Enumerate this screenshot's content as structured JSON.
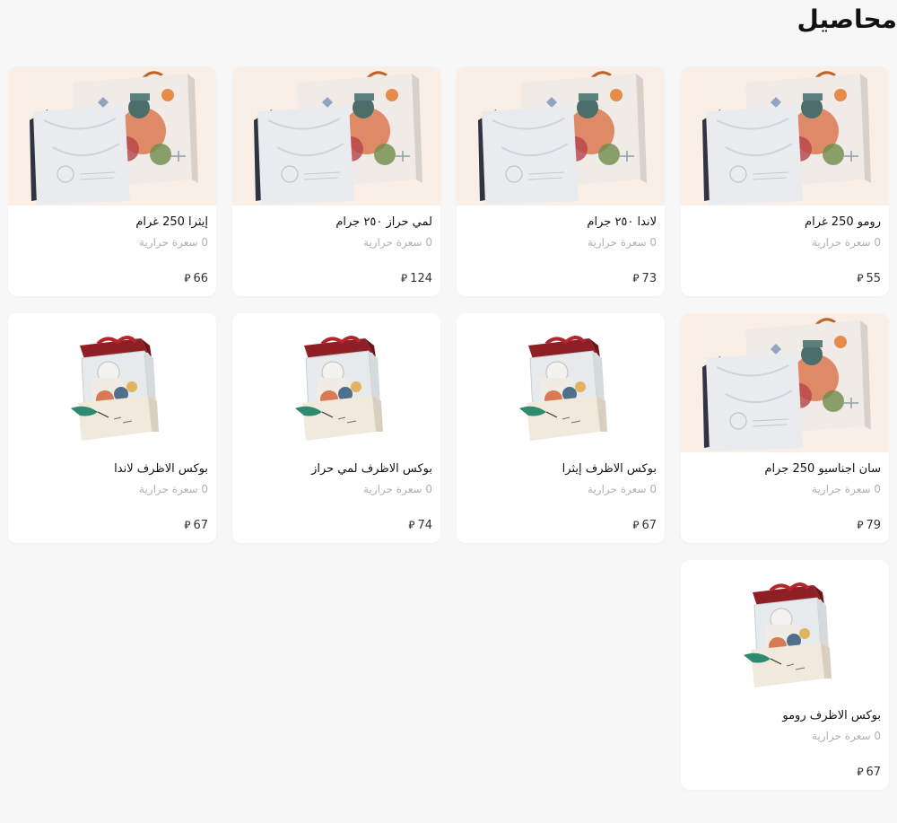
{
  "page": {
    "title": "محاصيل",
    "currency_symbol": "⃁",
    "calorie_label": "0 سعرة حرارية"
  },
  "products": [
    {
      "name": "رومو 250 غرام",
      "price": "55",
      "calories": "0 سعرة حرارية",
      "image": "coffee-bag-image"
    },
    {
      "name": "لاندا ٢٥٠ جرام",
      "price": "73",
      "calories": "0 سعرة حرارية",
      "image": "coffee-bag-image"
    },
    {
      "name": "لمي حراز ٢٥٠ جرام",
      "price": "124",
      "calories": "0 سعرة حرارية",
      "image": "coffee-bag-image"
    },
    {
      "name": "إيثرا 250 غرام",
      "price": "66",
      "calories": "0 سعرة حرارية",
      "image": "coffee-bag-image"
    },
    {
      "name": "سان اجناسيو 250 جرام",
      "price": "79",
      "calories": "0 سعرة حرارية",
      "image": "coffee-bag-image"
    },
    {
      "name": "بوكس الاظرف إيثرا",
      "price": "67",
      "calories": "0 سعرة حرارية",
      "image": "gift-box-image"
    },
    {
      "name": "بوكس الاظرف لمي حراز",
      "price": "74",
      "calories": "0 سعرة حرارية",
      "image": "gift-box-image"
    },
    {
      "name": "بوكس الاظرف لاندا",
      "price": "67",
      "calories": "0 سعرة حرارية",
      "image": "gift-box-image"
    },
    {
      "name": "بوكس الاظرف رومو",
      "price": "67",
      "calories": "0 سعرة حرارية",
      "image": "gift-box-image"
    }
  ]
}
